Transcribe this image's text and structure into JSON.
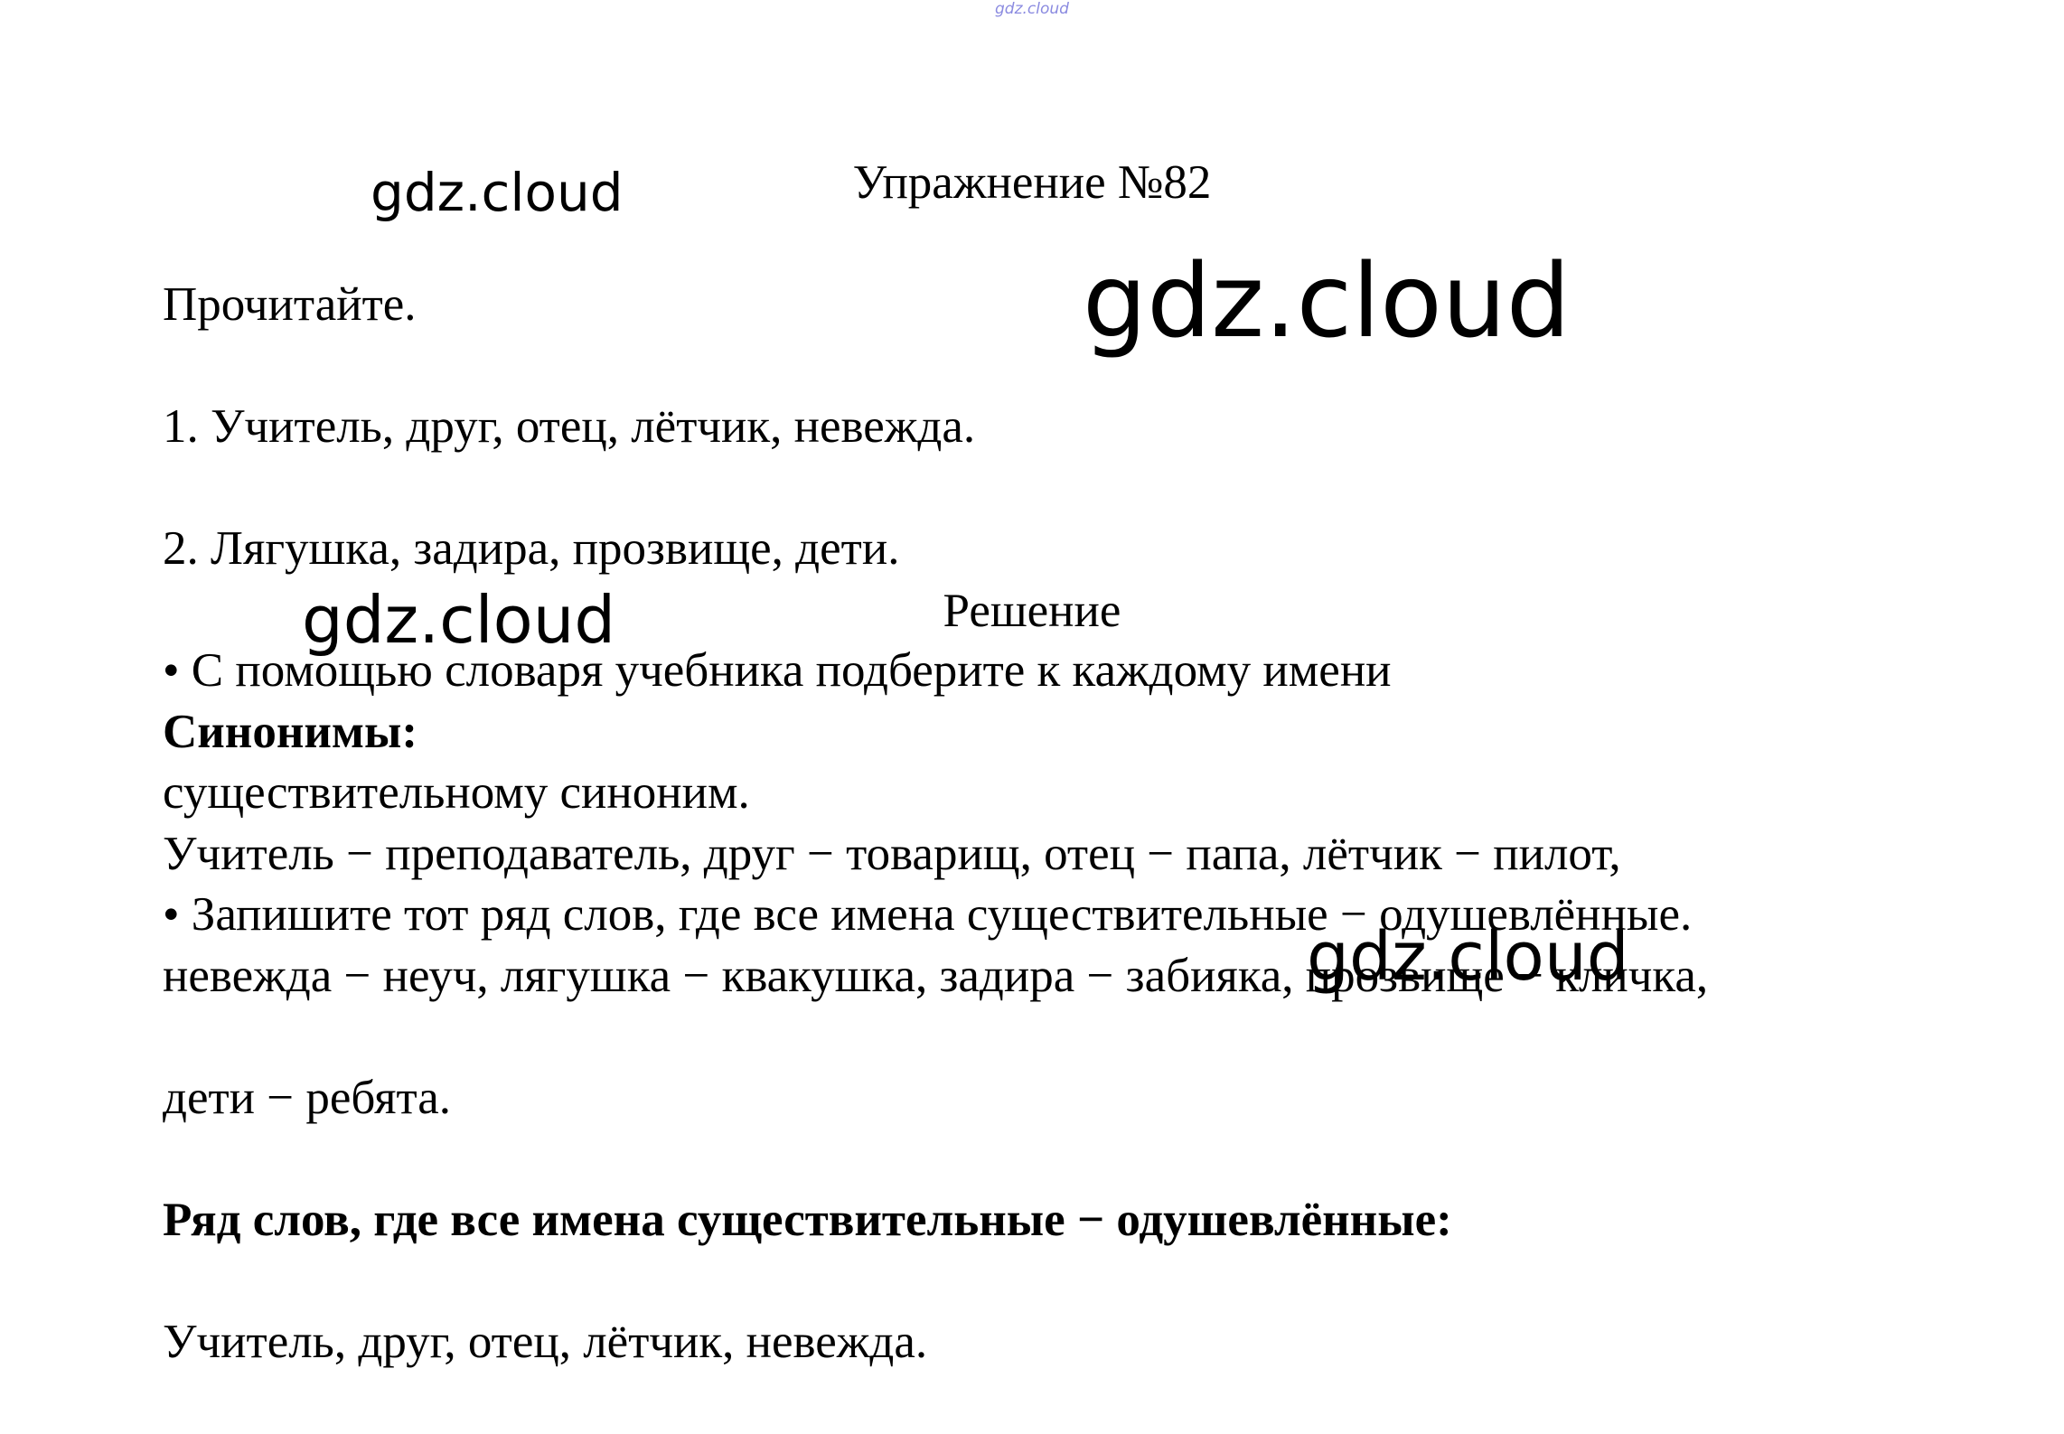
{
  "header": {
    "source_mark": "gdz.cloud"
  },
  "exercise": {
    "title": "Упражнение №82",
    "lines": [
      "Прочитайте.",
      "1. Учитель, друг, отец, лётчик, невежда.",
      "2. Лягушка, задира, прозвище, дети.",
      "• С помощью словаря учебника подберите к каждому имени",
      "существительному синоним.",
      "• Запишите тот ряд слов, где все имена существительные − одушевлённые."
    ]
  },
  "solution": {
    "title": "Решение",
    "synonyms_heading": "Синонимы:",
    "synonyms_lines": [
      "Учитель − преподаватель, друг − товарищ, отец − папа, лётчик − пилот,",
      "невежда − неуч, лягушка − квакушка, задира − забияка, прозвище − кличка,",
      "дети − ребята."
    ],
    "animate_heading": "Ряд слов, где все имена существительные − одушевлённые:",
    "animate_answer": "Учитель, друг, отец, лётчик, невежда."
  },
  "watermarks": [
    "gdz.cloud",
    "gdz.cloud",
    "gdz.cloud",
    "gdz.cloud"
  ]
}
